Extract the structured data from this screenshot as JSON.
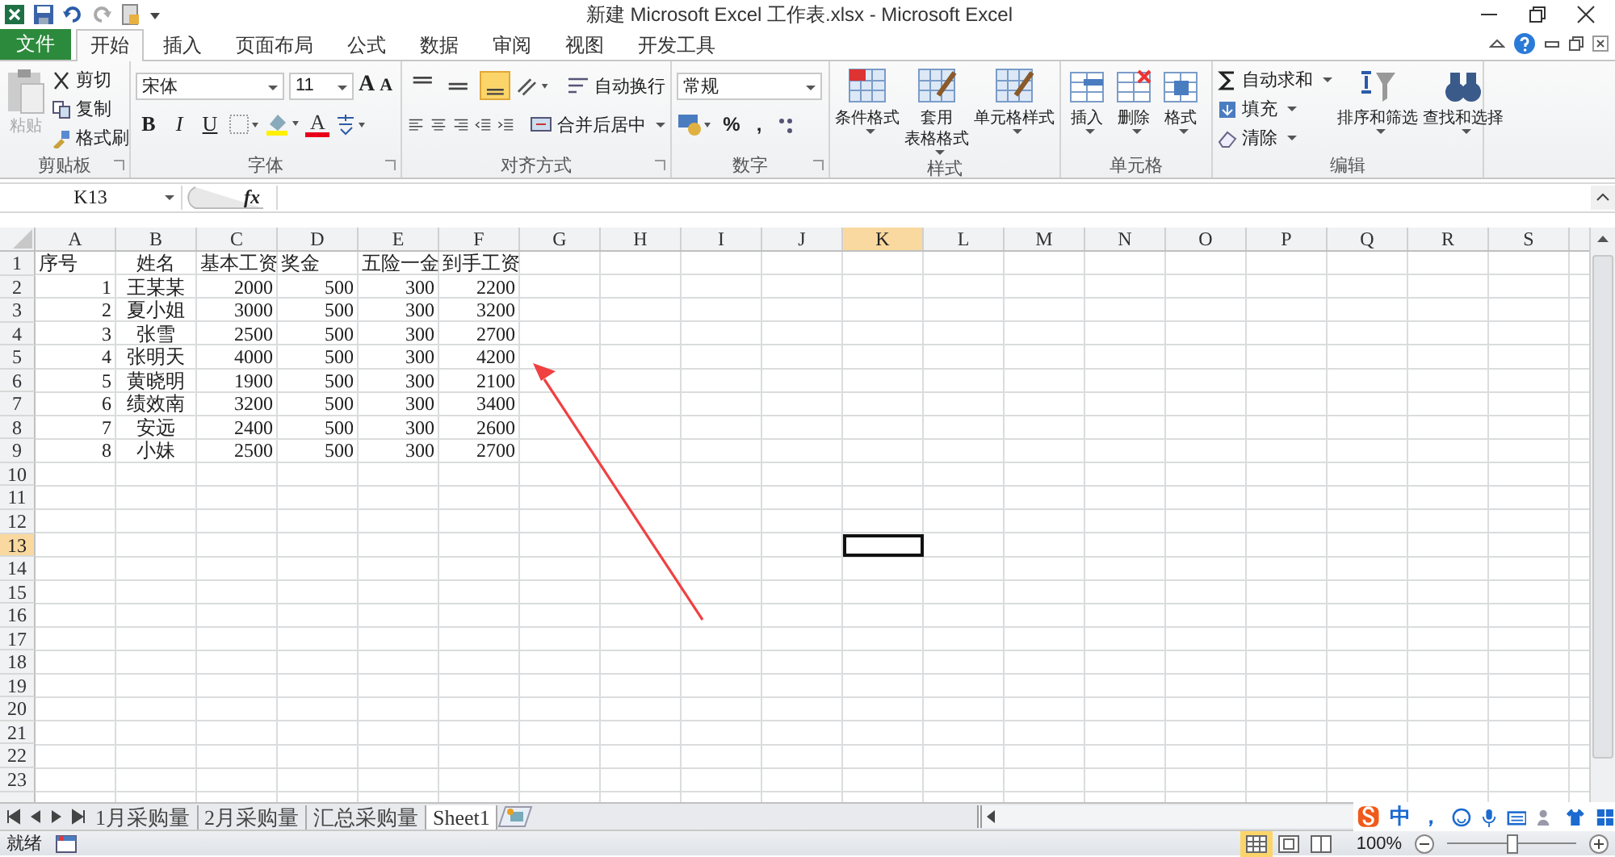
{
  "window": {
    "title": "新建 Microsoft Excel 工作表.xlsx - Microsoft Excel"
  },
  "tabs": [
    {
      "label": "文件",
      "kind": "file",
      "selected": false
    },
    {
      "label": "开始",
      "kind": "tab",
      "selected": true
    },
    {
      "label": "插入",
      "kind": "tab",
      "selected": false
    },
    {
      "label": "页面布局",
      "kind": "tab",
      "selected": false
    },
    {
      "label": "公式",
      "kind": "tab",
      "selected": false
    },
    {
      "label": "数据",
      "kind": "tab",
      "selected": false
    },
    {
      "label": "审阅",
      "kind": "tab",
      "selected": false
    },
    {
      "label": "视图",
      "kind": "tab",
      "selected": false
    },
    {
      "label": "开发工具",
      "kind": "tab",
      "selected": false
    }
  ],
  "ribbon": {
    "groups": [
      {
        "kind": "clipboard",
        "label": "剪贴板",
        "paste": {
          "label": "粘贴",
          "disabled": true
        },
        "items": [
          "剪切",
          "复制",
          "格式刷"
        ]
      },
      {
        "kind": "font",
        "label": "字体",
        "font_name": "宋体",
        "font_size": "11",
        "grow_shrink": [
          "A",
          "A"
        ],
        "styles": [
          "B",
          "I",
          "U"
        ],
        "font_color_letter": "A"
      },
      {
        "kind": "alignment",
        "label": "对齐方式",
        "vertical_align": [
          {
            "selected": false
          },
          {
            "selected": false
          },
          {
            "selected": true
          }
        ],
        "wrap": "自动换行",
        "merge": "合并后居中"
      },
      {
        "kind": "number",
        "label": "数字",
        "format": "常规",
        "symbols": [
          "%",
          ","
        ]
      },
      {
        "kind": "styles",
        "label": "样式",
        "buttons": [
          {
            "lines": [
              "条件格式"
            ]
          },
          {
            "lines": [
              "套用",
              "表格格式"
            ]
          },
          {
            "lines": [
              "单元格样式"
            ]
          }
        ]
      },
      {
        "kind": "cells",
        "label": "单元格",
        "buttons": [
          "插入",
          "删除",
          "格式"
        ]
      },
      {
        "kind": "editing",
        "label": "编辑",
        "small": [
          "自动求和",
          "填充",
          "清除"
        ],
        "buttons": [
          "排序和筛选",
          "查找和选择"
        ]
      }
    ]
  },
  "formula_bar": {
    "name_box": "K13",
    "fx": "fx"
  },
  "columns": [
    {
      "label": "A",
      "selected": false
    },
    {
      "label": "B",
      "selected": false
    },
    {
      "label": "C",
      "selected": false
    },
    {
      "label": "D",
      "selected": false
    },
    {
      "label": "E",
      "selected": false
    },
    {
      "label": "F",
      "selected": false
    },
    {
      "label": "G",
      "selected": false
    },
    {
      "label": "H",
      "selected": false
    },
    {
      "label": "I",
      "selected": false
    },
    {
      "label": "J",
      "selected": false
    },
    {
      "label": "K",
      "selected": true
    },
    {
      "label": "L",
      "selected": false
    },
    {
      "label": "M",
      "selected": false
    },
    {
      "label": "N",
      "selected": false
    },
    {
      "label": "O",
      "selected": false
    },
    {
      "label": "P",
      "selected": false
    },
    {
      "label": "Q",
      "selected": false
    },
    {
      "label": "R",
      "selected": false
    },
    {
      "label": "S",
      "selected": false
    }
  ],
  "rows": [
    {
      "number": "1",
      "selected": false,
      "cells": [
        "序号",
        "姓名",
        "基本工资",
        "奖金",
        "五险一金",
        "到手工资"
      ]
    },
    {
      "number": "2",
      "selected": false,
      "cells": [
        "1",
        "王某某",
        "2000",
        "500",
        "300",
        "2200"
      ]
    },
    {
      "number": "3",
      "selected": false,
      "cells": [
        "2",
        "夏小姐",
        "3000",
        "500",
        "300",
        "3200"
      ]
    },
    {
      "number": "4",
      "selected": false,
      "cells": [
        "3",
        "张雪",
        "2500",
        "500",
        "300",
        "2700"
      ]
    },
    {
      "number": "5",
      "selected": false,
      "cells": [
        "4",
        "张明天",
        "4000",
        "500",
        "300",
        "4200"
      ]
    },
    {
      "number": "6",
      "selected": false,
      "cells": [
        "5",
        "黄晓明",
        "1900",
        "500",
        "300",
        "2100"
      ]
    },
    {
      "number": "7",
      "selected": false,
      "cells": [
        "6",
        "绩效南",
        "3200",
        "500",
        "300",
        "3400"
      ]
    },
    {
      "number": "8",
      "selected": false,
      "cells": [
        "7",
        "安远",
        "2400",
        "500",
        "300",
        "2600"
      ]
    },
    {
      "number": "9",
      "selected": false,
      "cells": [
        "8",
        "小妹",
        "2500",
        "500",
        "300",
        "2700"
      ]
    },
    {
      "number": "10",
      "selected": false
    },
    {
      "number": "11",
      "selected": false
    },
    {
      "number": "12",
      "selected": false
    },
    {
      "number": "13",
      "selected": true
    },
    {
      "number": "14",
      "selected": false
    },
    {
      "number": "15",
      "selected": false
    },
    {
      "number": "16",
      "selected": false
    },
    {
      "number": "17",
      "selected": false
    },
    {
      "number": "18",
      "selected": false
    },
    {
      "number": "19",
      "selected": false
    },
    {
      "number": "20",
      "selected": false
    },
    {
      "number": "21",
      "selected": false
    },
    {
      "number": "22",
      "selected": false
    },
    {
      "number": "23",
      "selected": false
    }
  ],
  "sheet_tabs": [
    {
      "label": "1月采购量",
      "selected": false
    },
    {
      "label": "2月采购量",
      "selected": false
    },
    {
      "label": "汇总采购量",
      "selected": false
    },
    {
      "label": "Sheet1",
      "selected": true
    }
  ],
  "ime_bar": {
    "mode": "中",
    "punct": "，"
  },
  "status_bar": {
    "status": "就绪",
    "views": [
      {
        "selected": true
      },
      {
        "selected": false
      },
      {
        "selected": false
      }
    ],
    "zoom": "100%",
    "zoom_slider": {
      "level": 0.5
    }
  }
}
